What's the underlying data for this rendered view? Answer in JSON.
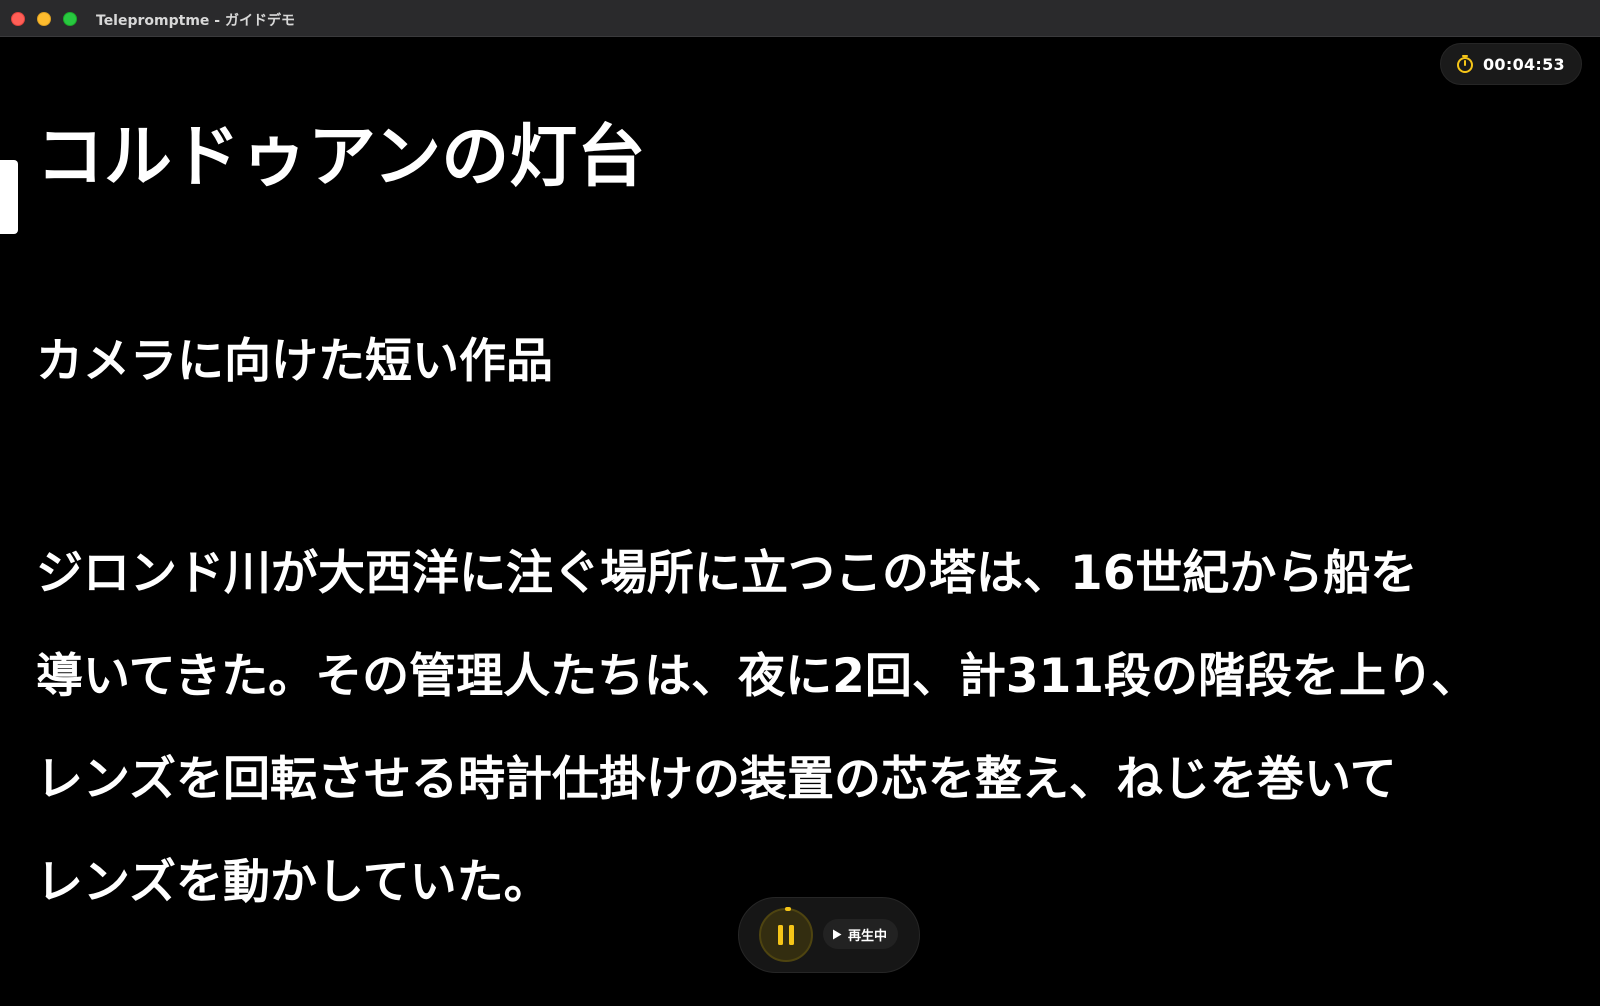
{
  "window": {
    "title": "Telepromptme - ガイドデモ"
  },
  "timer": {
    "elapsed": "00:04:53",
    "icon": "timer-icon",
    "accent_color": "#f5c518"
  },
  "script": {
    "title": "コルドゥアンの灯台",
    "subtitle": "カメラに向けた短い作品",
    "body_lines": [
      "ジロンド川が大西洋に注ぐ場所に立つこの塔は、16世紀から船を",
      "導いてきた。その管理人たちは、夜に2回、計311段の階段を上り、",
      "レンズを回転させる時計仕掛けの装置の芯を整え、ねじを巻いて",
      "レンズを動かしていた。"
    ]
  },
  "controls": {
    "pause_icon": "pause-icon",
    "status_icon": "play-icon",
    "status_label": "再生中",
    "accent_color": "#f5c518"
  }
}
